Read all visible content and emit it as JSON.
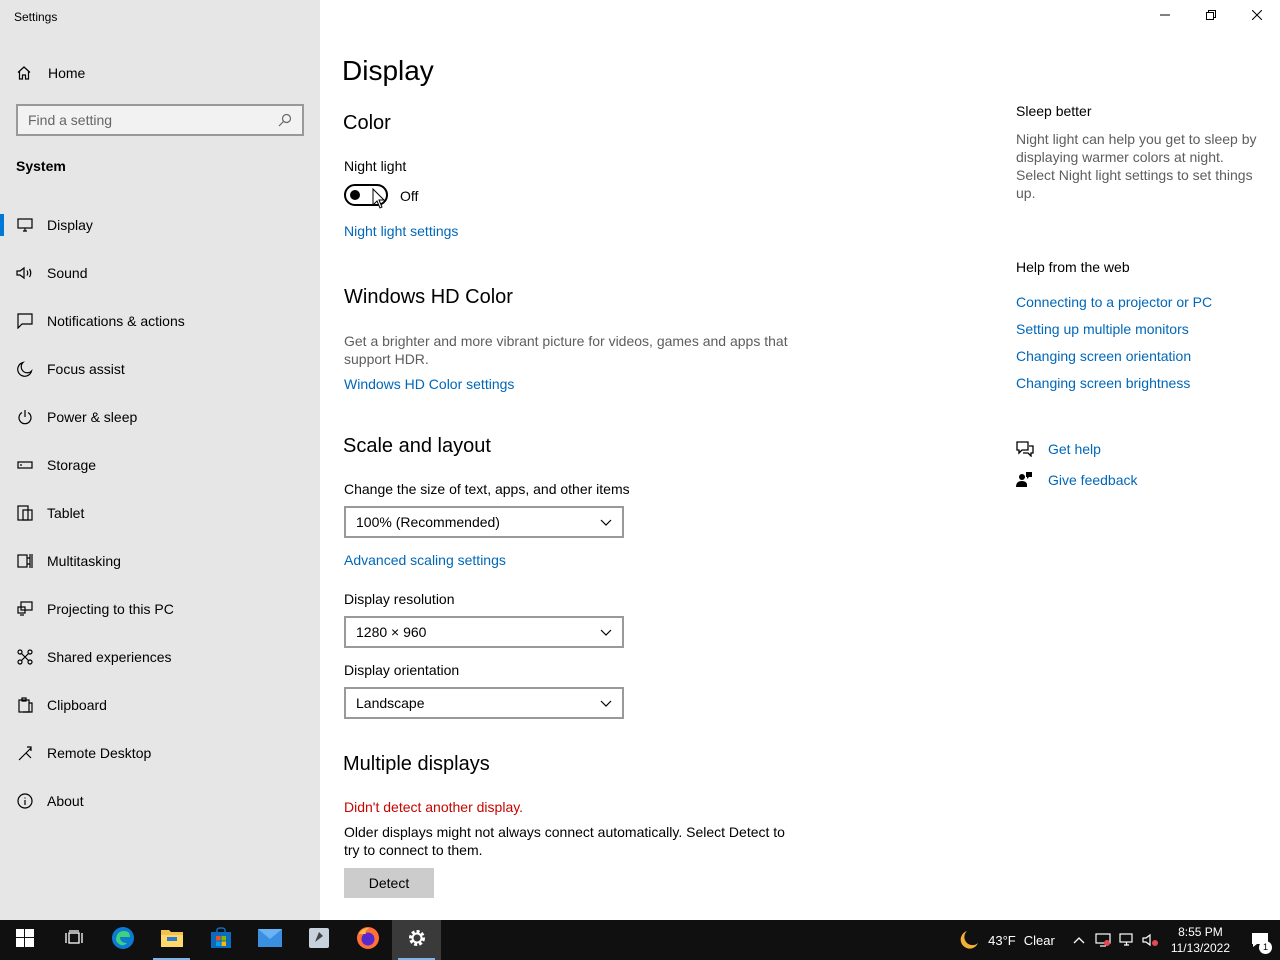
{
  "window": {
    "title": "Settings"
  },
  "sidebar": {
    "home_label": "Home",
    "search_placeholder": "Find a setting",
    "section": "System",
    "items": [
      {
        "label": "Display",
        "icon": "monitor-icon",
        "active": true
      },
      {
        "label": "Sound",
        "icon": "speaker-icon"
      },
      {
        "label": "Notifications & actions",
        "icon": "notification-icon"
      },
      {
        "label": "Focus assist",
        "icon": "moon-icon"
      },
      {
        "label": "Power & sleep",
        "icon": "power-icon"
      },
      {
        "label": "Storage",
        "icon": "storage-icon"
      },
      {
        "label": "Tablet",
        "icon": "tablet-icon"
      },
      {
        "label": "Multitasking",
        "icon": "multitasking-icon"
      },
      {
        "label": "Projecting to this PC",
        "icon": "projecting-icon"
      },
      {
        "label": "Shared experiences",
        "icon": "shared-icon"
      },
      {
        "label": "Clipboard",
        "icon": "clipboard-icon"
      },
      {
        "label": "Remote Desktop",
        "icon": "remote-desktop-icon"
      },
      {
        "label": "About",
        "icon": "info-icon"
      }
    ]
  },
  "main": {
    "title": "Display",
    "color": {
      "heading": "Color",
      "night_light_label": "Night light",
      "toggle_state": "Off",
      "night_light_link": "Night light settings"
    },
    "hd_color": {
      "heading": "Windows HD Color",
      "description": "Get a brighter and more vibrant picture for videos, games and apps that support HDR.",
      "link": "Windows HD Color settings"
    },
    "scale": {
      "heading": "Scale and layout",
      "size_label": "Change the size of text, apps, and other items",
      "size_value": "100% (Recommended)",
      "advanced_link": "Advanced scaling settings",
      "resolution_label": "Display resolution",
      "resolution_value": "1280 × 960",
      "orientation_label": "Display orientation",
      "orientation_value": "Landscape"
    },
    "multiple": {
      "heading": "Multiple displays",
      "error": "Didn't detect another display.",
      "description": "Older displays might not always connect automatically. Select Detect to try to connect to them.",
      "detect_button": "Detect"
    }
  },
  "right_pane": {
    "sleep_title": "Sleep better",
    "sleep_desc": "Night light can help you get to sleep by displaying warmer colors at night. Select Night light settings to set things up.",
    "help_title": "Help from the web",
    "help_links": [
      "Connecting to a projector or PC",
      "Setting up multiple monitors",
      "Changing screen orientation",
      "Changing screen brightness"
    ],
    "get_help": "Get help",
    "give_feedback": "Give feedback"
  },
  "taskbar": {
    "weather_temp": "43°F",
    "weather_cond": "Clear",
    "time": "8:55 PM",
    "date": "11/13/2022",
    "notification_count": "1"
  },
  "colors": {
    "accent": "#0078d7",
    "link": "#0067b8",
    "error": "#c50500",
    "sidebar_bg": "#e6e6e6",
    "taskbar_bg": "#101010"
  }
}
